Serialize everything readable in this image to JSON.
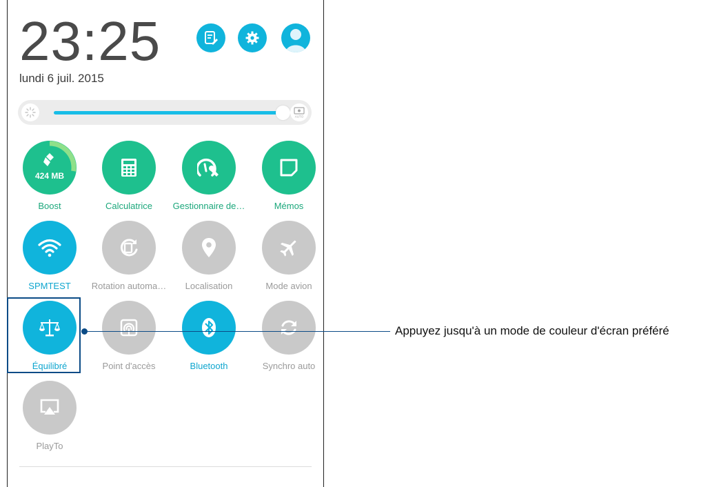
{
  "status": {
    "time": "23:25",
    "date": "lundi 6 juil. 2015"
  },
  "header_icons": [
    {
      "icon": "edit-note-icon"
    },
    {
      "icon": "gear-icon"
    },
    {
      "icon": "user-avatar-icon"
    }
  ],
  "brightness": {
    "level": 0.92,
    "auto_label": "AUTO"
  },
  "tiles": {
    "boost": {
      "label": "Boost",
      "value": "424 MB",
      "state": "active",
      "icon": "broom-icon"
    },
    "calculator": {
      "label": "Calculatrice",
      "state": "active",
      "icon": "calculator-icon"
    },
    "manager": {
      "label": "Gestionnaire de…",
      "state": "active",
      "icon": "speedometer-wrench-icon"
    },
    "memos": {
      "label": "Mémos",
      "state": "active",
      "icon": "note-icon"
    },
    "wifi": {
      "label": "SPMTEST",
      "state": "on",
      "icon": "wifi-icon"
    },
    "rotation": {
      "label": "Rotation automa…",
      "state": "off",
      "icon": "rotation-icon"
    },
    "location": {
      "label": "Localisation",
      "state": "off",
      "icon": "location-pin-icon"
    },
    "airplane": {
      "label": "Mode avion",
      "state": "off",
      "icon": "airplane-icon"
    },
    "balanced": {
      "label": "Équilibré",
      "state": "on",
      "icon": "balance-scale-icon"
    },
    "hotspot": {
      "label": "Point d'accès",
      "state": "off",
      "icon": "hotspot-icon"
    },
    "bluetooth": {
      "label": "Bluetooth",
      "state": "on",
      "icon": "bluetooth-icon"
    },
    "sync": {
      "label": "Synchro auto",
      "state": "off",
      "icon": "sync-icon"
    },
    "playto": {
      "label": "PlayTo",
      "state": "off",
      "icon": "cast-icon"
    }
  },
  "callout": {
    "text": "Appuyez jusqu'à un mode de couleur d'écran préféré"
  },
  "colors": {
    "accent_blue": "#10b4dc",
    "accent_green": "#1ec08e",
    "inactive_grey": "#c9c9c9",
    "callout_navy": "#0b4b86"
  }
}
